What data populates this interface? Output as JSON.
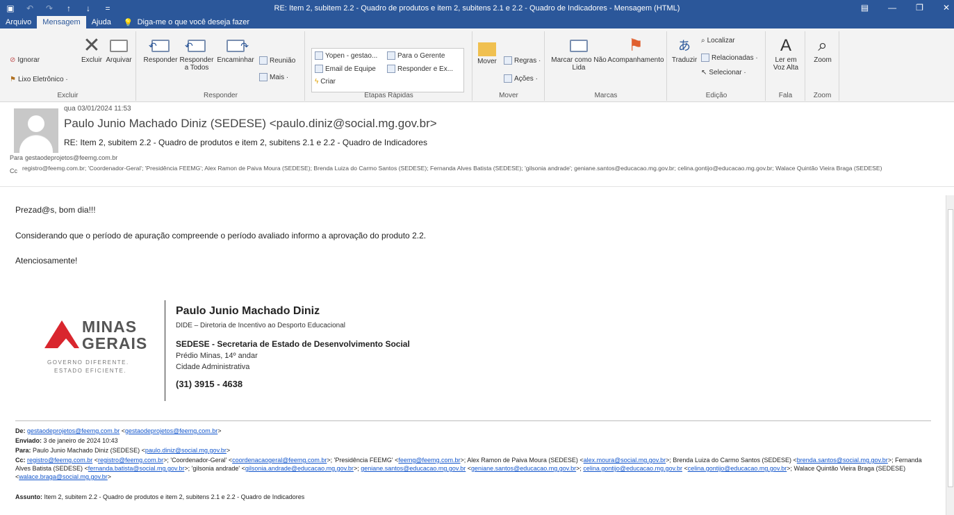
{
  "window": {
    "title": "RE: Item 2, subitem 2.2 - Quadro de produtos e item 2, subitens 2.1 e 2.2 - Quadro de Indicadores  -  Mensagem (HTML)"
  },
  "tabs": [
    {
      "label": "Arquivo"
    },
    {
      "label": "Mensagem"
    },
    {
      "label": "Ajuda"
    }
  ],
  "tell_me": "Diga-me o que você deseja fazer",
  "ribbon": {
    "excluir": {
      "label": "Excluir",
      "ignorar": "Ignorar",
      "lixo": "Lixo Eletrônico ·",
      "excluir_btn": "Excluir",
      "arquivar": "Arquivar"
    },
    "responder": {
      "label": "Responder",
      "responder": "Responder",
      "responder_todos": "Responder a Todos",
      "encaminhar": "Encaminhar",
      "reuniao": "Reunião",
      "mais": "Mais ·"
    },
    "etapas": {
      "label": "Etapas Rápidas",
      "items": [
        "Yopen - gestao...",
        "Para o Gerente",
        "Email de Equipe",
        "Responder e Ex...",
        "Criar"
      ]
    },
    "mover": {
      "label": "Mover",
      "mover": "Mover",
      "regras": "Regras ·",
      "acoes": "Ações ·"
    },
    "marcas": {
      "label": "Marcas",
      "marcar": "Marcar como Não Lida",
      "acompanhamento": "Acompanhamento"
    },
    "edicao": {
      "label": "Edição",
      "traduzir": "Traduzir",
      "localizar": "Localizar",
      "relacionadas": "Relacionadas ·",
      "selecionar": "Selecionar ·"
    },
    "fala": {
      "label": "Fala",
      "ler": "Ler em Voz Alta"
    },
    "zoom": {
      "label": "Zoom",
      "zoom": "Zoom"
    }
  },
  "header": {
    "datetime": "qua 03/01/2024 11:53",
    "from": "Paulo Junio Machado Diniz (SEDESE) <paulo.diniz@social.mg.gov.br>",
    "subject": "RE: Item 2, subitem 2.2 - Quadro de produtos e item 2, subitens  2.1 e 2.2 - Quadro de Indicadores",
    "to_label": "Para",
    "to": "gestaodeprojetos@feemg.com.br",
    "cc_label": "Cc",
    "cc": "registro@feemg.com.br; 'Coordenador-Geral'; 'Presidência  FEEMG'; Alex Ramon de Paiva Moura (SEDESE); Brenda Luiza do Carmo Santos (SEDESE); Fernanda Alves Batista (SEDESE); 'gilsonia andrade'; geniane.santos@educacao.mg.gov.br; celina.gontijo@educacao.mg.gov.br; Walace Quintão Vieira Braga (SEDESE)"
  },
  "message": {
    "greeting": "Prezad@s, bom dia!!!",
    "line1": "Considerando que o período de apuração compreende o período avaliado informo a aprovação do produto 2.2.",
    "closing": "Atenciosamente!"
  },
  "signature": {
    "logo_line1": "MINAS",
    "logo_line2": "GERAIS",
    "logo_tag1": "GOVERNO DIFERENTE.",
    "logo_tag2": "ESTADO EFICIENTE.",
    "name": "Paulo Junio Machado Diniz",
    "dept": "DIDE – Diretoria de Incentivo ao Desporto Educacional",
    "org": "SEDESE - Secretaria de Estado de Desenvolvimento Social",
    "addr1": "Prédio Minas, 14º andar",
    "addr2": "Cidade Administrativa",
    "phone": "(31) 3915 - 4638"
  },
  "forwarded": {
    "de_label": "De:",
    "de_link1": "gestaodeprojetos@feemg.com.br",
    "de_link2": "gestaodeprojetos@feemg.com.br",
    "enviado_label": "Enviado:",
    "enviado": "3 de janeiro de 2024 10:43",
    "para_label": "Para:",
    "para_name": "Paulo Junio Machado Diniz (SEDESE) <",
    "para_link": "paulo.diniz@social.mg.gov.br",
    "cc_label": "Cc:",
    "cc_l1": "registro@feemg.com.br",
    "cc_l2": "registro@feemg.com.br",
    "cc_t1": "'Coordenador-Geral' <",
    "cc_l3": "coordenacaogeral@feemg.com.br",
    "cc_t2": "'Presidência FEEMG' <",
    "cc_l4": "feemg@feemg.com.br",
    "cc_t3": "Alex Ramon de Paiva Moura (SEDESE) <",
    "cc_l5": "alex.moura@social.mg.gov.br",
    "cc_t4": "Brenda Luiza do Carmo Santos (SEDESE) <",
    "cc_l6": "brenda.santos@social.mg.gov.br",
    "cc_t5": "Fernanda Alves Batista (SEDESE) <",
    "cc_l7": "fernanda.batista@social.mg.gov.br",
    "cc_t6": "'gilsonia andrade' <",
    "cc_l8": "gilsonia.andrade@educacao.mg.gov.br",
    "cc_l9": "geniane.santos@educacao.mg.gov.br",
    "cc_l10": "geniane.santos@educacao.mg.gov.br",
    "cc_l11": "celina.gontijo@educacao.mg.gov.br",
    "cc_l12": "celina.gontijo@educacao.mg.gov.br",
    "cc_t7": "Walace Quintão Vieira Braga (SEDESE) <",
    "cc_l13": "walace.braga@social.mg.gov.br",
    "assunto_label": "Assunto:",
    "assunto": "Item 2, subitem 2.2 - Quadro de produtos e item 2, subitens 2.1 e 2.2 - Quadro de Indicadores"
  }
}
